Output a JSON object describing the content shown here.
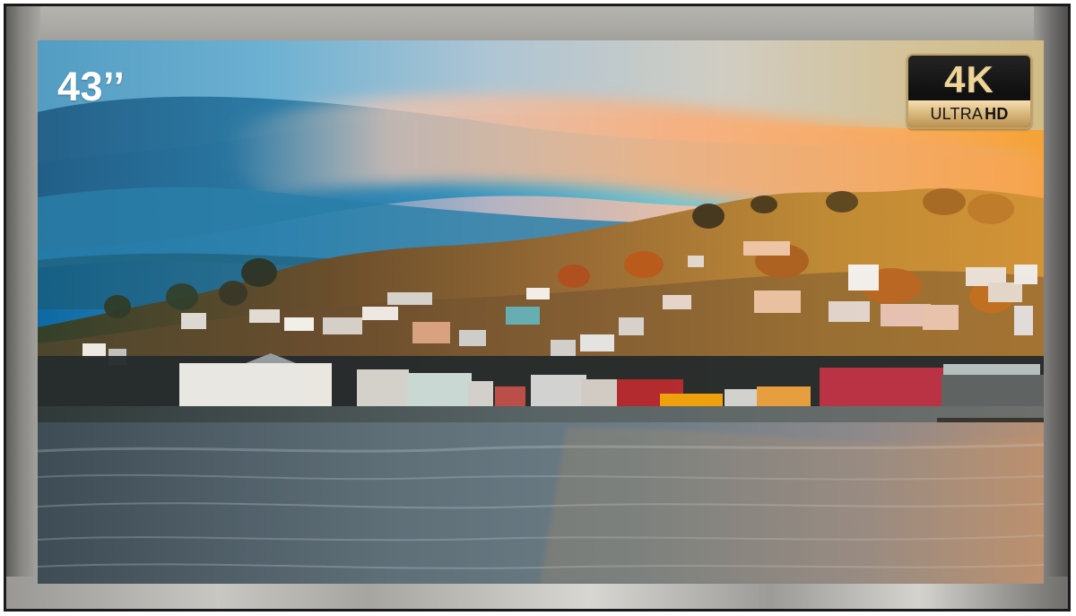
{
  "display": {
    "size_label": "43’’",
    "badge": {
      "resolution": "4K",
      "ultra": "ULTRA",
      "hd": "HD"
    }
  },
  "colors": {
    "frame_edge": "#1a1a1a",
    "badge_gold": "#d7b57a",
    "badge_black": "#111111",
    "sunset_orange": "#f3a43c",
    "sky_blue": "#2e8cc0",
    "water_gray": "#6d7c86"
  }
}
